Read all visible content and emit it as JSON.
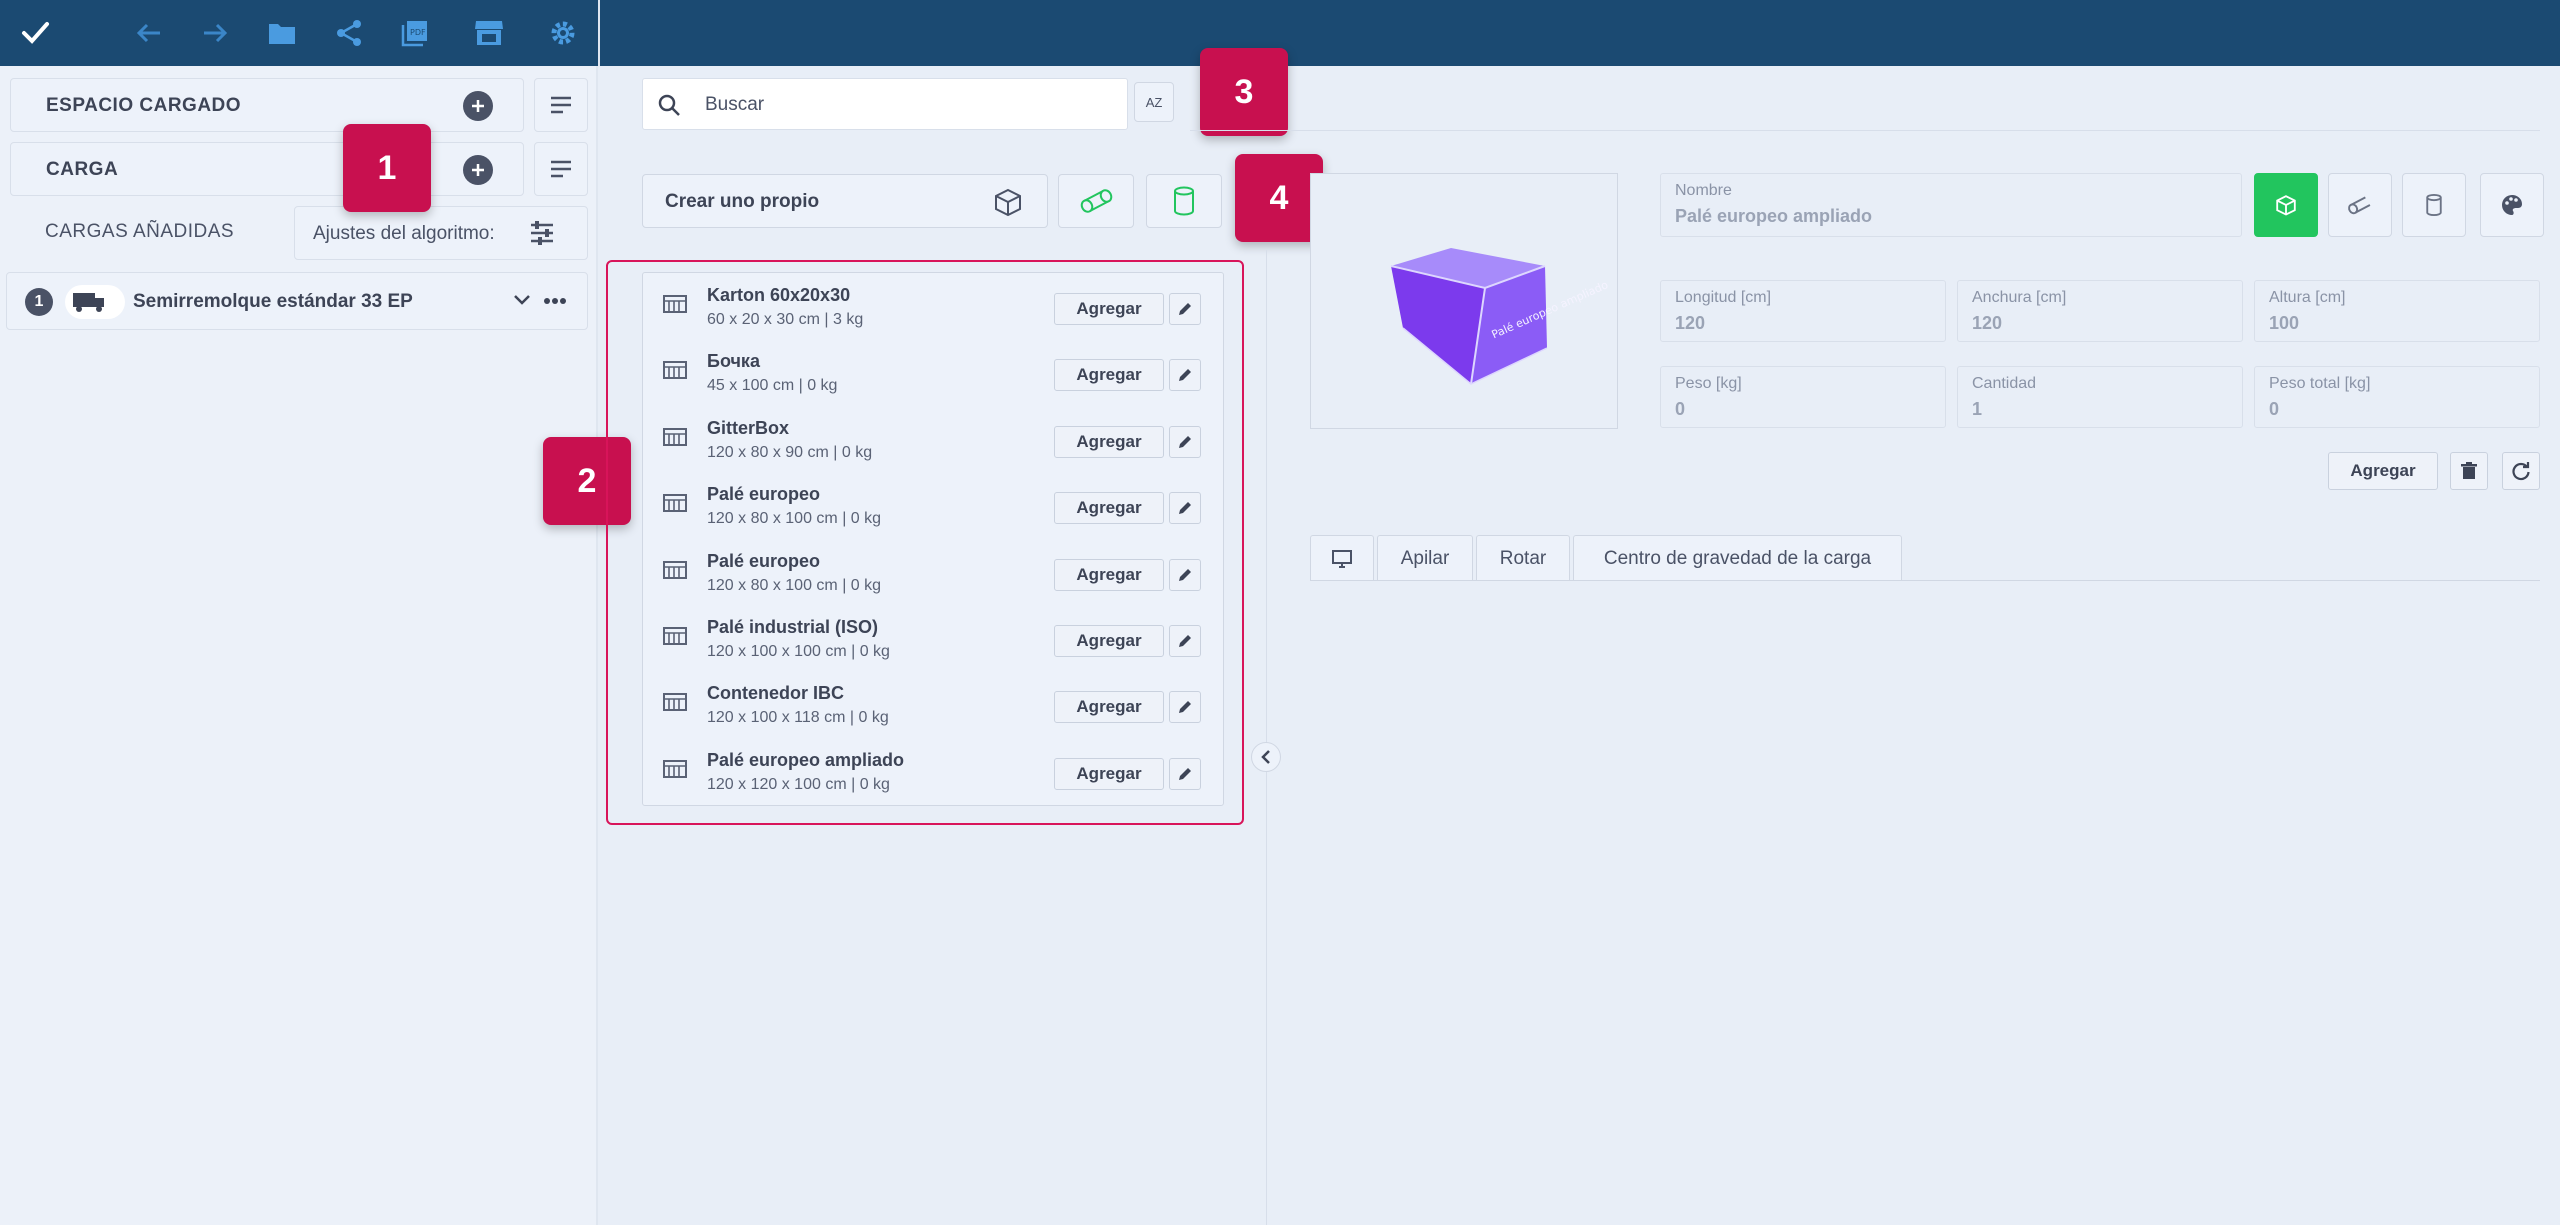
{
  "toolbar": {
    "icons": [
      "check-icon",
      "back-arrow-icon",
      "forward-arrow-icon",
      "folder-icon",
      "share-icon",
      "pdf-icon",
      "store-icon",
      "gear-icon"
    ]
  },
  "sidebar": {
    "loaded_space_label": "ESPACIO CARGADO",
    "cargo_label": "CARGA",
    "added_loads_label": "CARGAS AÑADIDAS",
    "algorithm_settings_label": "Ajustes del algoritmo:",
    "truck": {
      "number": "1",
      "title": "Semirremolque estándar 33 EP"
    }
  },
  "badges": [
    "1",
    "2",
    "3",
    "4"
  ],
  "search": {
    "placeholder": "Buscar",
    "sort_label": "AZ"
  },
  "create": {
    "label": "Crear uno propio"
  },
  "items": [
    {
      "name": "Karton 60x20x30",
      "dims": "60 x 20 x 30 cm | 3 kg"
    },
    {
      "name": "Бочка",
      "dims": "45 x 100 cm | 0 kg"
    },
    {
      "name": "GitterBox",
      "dims": "120 x 80 x 90 cm | 0 kg"
    },
    {
      "name": "Palé europeo",
      "dims": "120 x 80 x 100 cm | 0 kg"
    },
    {
      "name": "Palé europeo",
      "dims": "120 x 80 x 100 cm | 0 kg"
    },
    {
      "name": "Palé industrial (ISO)",
      "dims": "120 x 100 x 100 cm | 0 kg"
    },
    {
      "name": "Contenedor IBC",
      "dims": "120 x 100 x 118 cm | 0 kg"
    },
    {
      "name": "Palé europeo ampliado",
      "dims": "120 x 120 x 100 cm | 0 kg"
    }
  ],
  "add_label": "Agregar",
  "detail": {
    "preview_text": "Palé europeo ampliado",
    "name_label": "Nombre",
    "name_value": "Palé europeo ampliado",
    "length_label": "Longitud [cm]",
    "length_value": "120",
    "width_label": "Anchura [cm]",
    "width_value": "120",
    "height_label": "Altura [cm]",
    "height_value": "100",
    "weight_label": "Peso [kg]",
    "weight_value": "0",
    "qty_label": "Cantidad",
    "qty_value": "1",
    "total_weight_label": "Peso total [kg]",
    "total_weight_value": "0",
    "add_label": "Agregar"
  },
  "tabs": [
    "Apilar",
    "Rotar",
    "Centro de gravedad de la carga"
  ],
  "colors": {
    "topbar": "#1b4a72",
    "badge": "#c8104f",
    "active_shape": "#22c55e",
    "cube": "#8b5cf6"
  }
}
